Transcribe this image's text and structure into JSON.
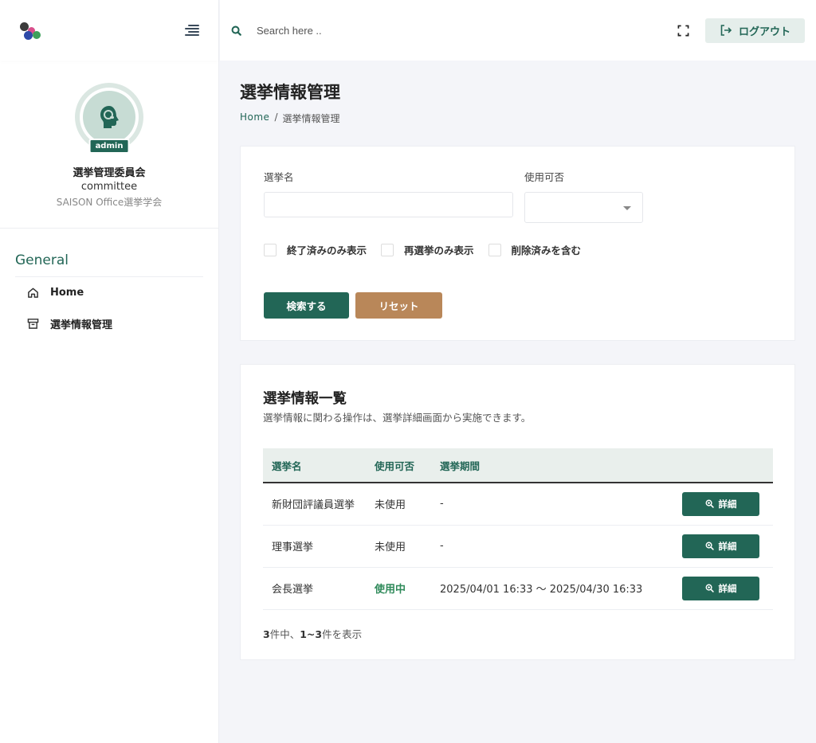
{
  "sidebar": {
    "profile": {
      "role_badge": "admin",
      "name": "選挙管理委員会",
      "user_id": "committee",
      "organization": "SAISON Office選挙学会"
    },
    "nav_section_title": "General",
    "nav_items": [
      {
        "label": "Home",
        "icon": "home-icon"
      },
      {
        "label": "選挙情報管理",
        "icon": "archive-icon"
      }
    ]
  },
  "header": {
    "search_placeholder": "Search here ..",
    "logout_label": "ログアウト"
  },
  "page": {
    "title": "選挙情報管理",
    "breadcrumb": {
      "home": "Home",
      "separator": "/",
      "current": "選挙情報管理"
    }
  },
  "search_form": {
    "name_label": "選挙名",
    "name_value": "",
    "availability_label": "使用可否",
    "availability_value": "",
    "checkboxes": [
      {
        "label": "終了済みのみ表示",
        "checked": false
      },
      {
        "label": "再選挙のみ表示",
        "checked": false
      },
      {
        "label": "削除済みを含む",
        "checked": false
      }
    ],
    "search_button": "検索する",
    "reset_button": "リセット"
  },
  "list": {
    "title": "選挙情報一覧",
    "description": "選挙情報に関わる操作は、選挙詳細画面から実施できます。",
    "columns": [
      "選挙名",
      "使用可否",
      "選挙期間",
      ""
    ],
    "rows": [
      {
        "name": "新財団評議員選挙",
        "status": "未使用",
        "period": "-",
        "action": "詳細"
      },
      {
        "name": "理事選挙",
        "status": "未使用",
        "period": "-",
        "action": "詳細"
      },
      {
        "name": "会長選挙",
        "status": "使用中",
        "period": "2025/04/01 16:33 〜 2025/04/30 16:33",
        "action": "詳細"
      }
    ],
    "pagination": {
      "total": "3",
      "total_suffix": "件中、",
      "range": "1~3",
      "range_suffix": "件を表示"
    }
  },
  "colors": {
    "primary": "#226656",
    "reset": "#b98759",
    "active_status": "#2f8a5a"
  }
}
